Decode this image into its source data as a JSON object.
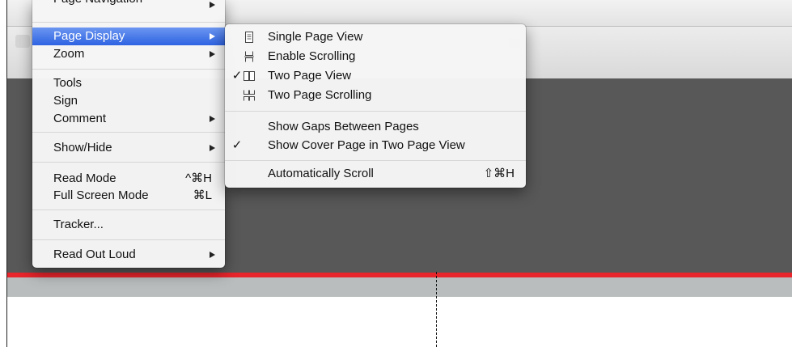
{
  "main_menu": {
    "items": [
      {
        "label": "Page Navigation",
        "submenu": true
      },
      {
        "label": "Page Display",
        "submenu": true
      },
      {
        "label": "Zoom",
        "submenu": true
      },
      {
        "label": "Tools"
      },
      {
        "label": "Sign"
      },
      {
        "label": "Comment",
        "submenu": true
      },
      {
        "label": "Show/Hide",
        "submenu": true
      },
      {
        "label": "Read Mode",
        "shortcut": "^⌘H"
      },
      {
        "label": "Full Screen Mode",
        "shortcut": "⌘L"
      },
      {
        "label": "Tracker..."
      },
      {
        "label": "Read Out Loud",
        "submenu": true
      }
    ]
  },
  "page_display_submenu": {
    "items": [
      {
        "label": "Single Page View",
        "icon": "single-page-icon",
        "checked": false
      },
      {
        "label": "Enable Scrolling",
        "icon": "scrolling-icon",
        "checked": false
      },
      {
        "label": "Two Page View",
        "icon": "two-page-icon",
        "checked": true
      },
      {
        "label": "Two Page Scrolling",
        "icon": "two-page-scrolling-icon",
        "checked": false
      },
      {
        "label": "Show Gaps Between Pages",
        "checked": false
      },
      {
        "label": "Show Cover Page in Two Page View",
        "checked": true
      },
      {
        "label": "Automatically Scroll",
        "shortcut": "⇧⌘H",
        "checked": false
      }
    ],
    "check_glyph": "✓"
  },
  "colors": {
    "highlight": "#2e63e2",
    "workspace": "#585858",
    "accent_red": "#e8252b",
    "ruler": "#b9bdbd"
  }
}
